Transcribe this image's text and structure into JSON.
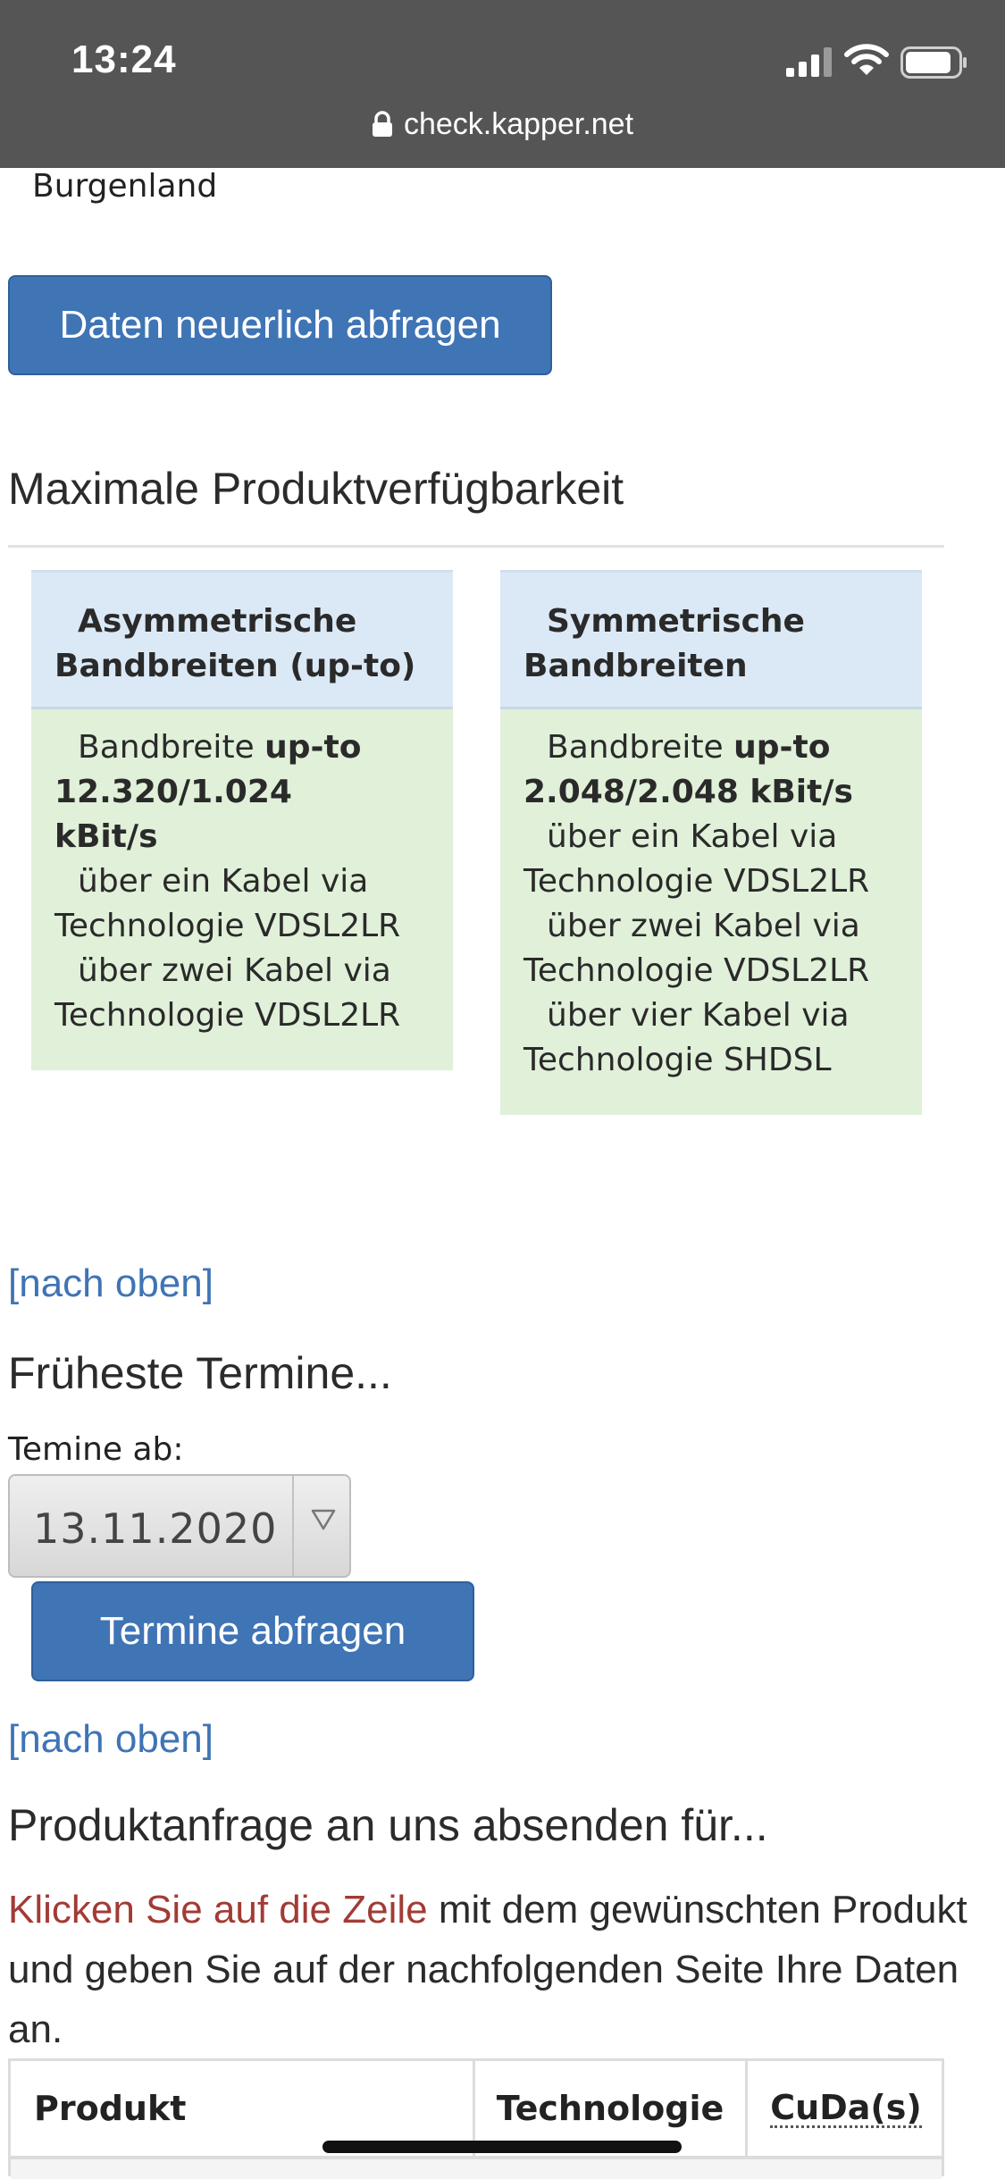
{
  "status_bar": {
    "time": "13:24",
    "url": "check.kapper.net"
  },
  "region": "Burgenland",
  "requery_button": "Daten neuerlich abfragen",
  "availability": {
    "heading": "Maximale Produktverfügbarkeit",
    "asymmetric": {
      "header": "Asymmetrische Bandbreiten (up-to)",
      "bandwidth_prefix": "Bandbreite ",
      "bandwidth_upto": "up-to",
      "bandwidth_value": "12.320/1.024 kBit/s",
      "lines": [
        "über ein Kabel via",
        "Technologie VDSL2LR",
        "über zwei Kabel via",
        "Technologie VDSL2LR"
      ]
    },
    "symmetric": {
      "header": "Symmetrische Bandbreiten",
      "bandwidth_prefix": "Bandbreite ",
      "bandwidth_upto": "up-to",
      "bandwidth_value": "2.048/2.048 kBit/s",
      "lines": [
        "über ein Kabel via",
        "Technologie VDSL2LR",
        "über zwei Kabel via",
        "Technologie VDSL2LR",
        "über vier Kabel via",
        "Technologie SHDSL"
      ]
    }
  },
  "back_to_top": "[nach oben]",
  "appointments": {
    "heading": "Früheste Termine...",
    "label": "Temine ab:",
    "date_value": "13.11.2020",
    "button": "Termine abfragen"
  },
  "product_request": {
    "heading": "Produktanfrage an uns absenden für...",
    "instruction_link": "Klicken Sie auf die Zeile",
    "instruction_rest": " mit dem gewünschten Produkt und geben Sie auf der nachfolgenden Seite Ihre Daten an.",
    "table_headers": {
      "product": "Produkt",
      "technology": "Technologie",
      "cuda": "CuDa(s)"
    }
  },
  "colors": {
    "chrome": "#555555",
    "button": "#3f74b5",
    "card_header": "#dbe9f6",
    "card_body": "#e1f0d9",
    "link": "#3f74b5",
    "highlight_text": "#a23b35"
  }
}
